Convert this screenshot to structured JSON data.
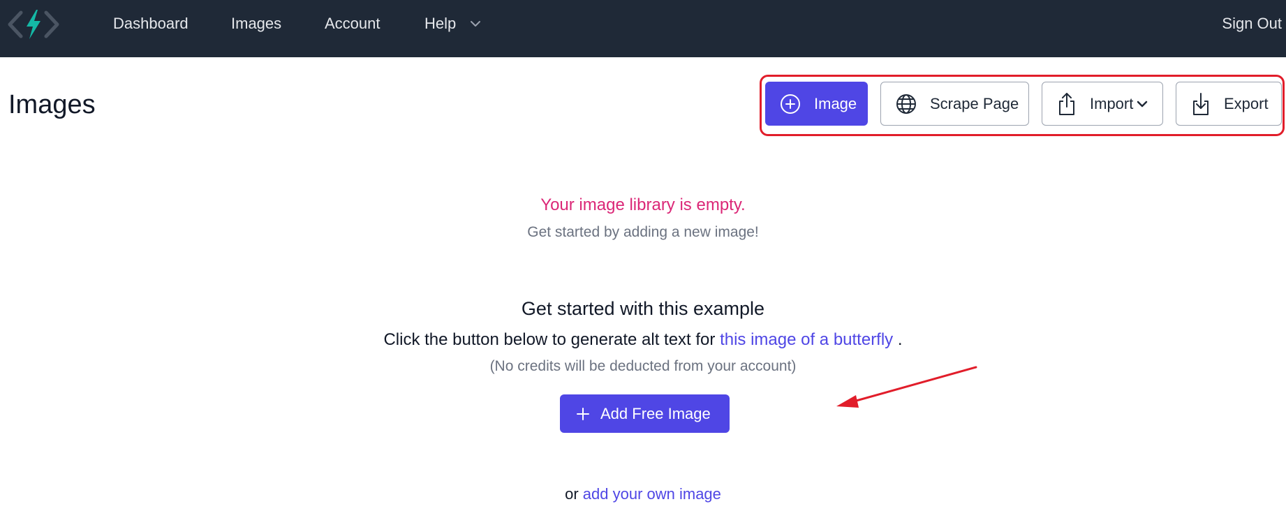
{
  "nav": {
    "items": [
      {
        "label": "Dashboard"
      },
      {
        "label": "Images"
      },
      {
        "label": "Account"
      },
      {
        "label": "Help"
      }
    ],
    "sign_out": "Sign Out"
  },
  "page": {
    "title": "Images"
  },
  "actions": {
    "image": "Image",
    "scrape": "Scrape Page",
    "import": "Import",
    "export": "Export"
  },
  "empty_state": {
    "title": "Your image library is empty.",
    "subtitle": "Get started by adding a new image!"
  },
  "example": {
    "title": "Get started with this example",
    "text_prefix": "Click the button below to generate alt text for",
    "link": "this image of a butterfly",
    "text_suffix": ".",
    "note": "(No credits will be deducted from your account)",
    "button": "Add Free Image",
    "or_prefix": "or",
    "or_link": "add your own image"
  },
  "colors": {
    "nav_bg": "#1f2937",
    "accent": "#4f46e5",
    "empty_title": "#db2777",
    "highlight": "#e11d2a"
  }
}
